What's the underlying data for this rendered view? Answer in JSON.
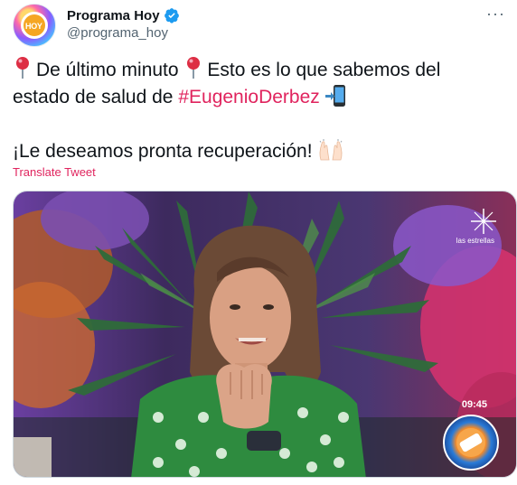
{
  "tweet": {
    "author": {
      "display_name": "Programa Hoy",
      "handle": "@programa_hoy",
      "verified": true,
      "avatar_icon": "programa-hoy-logo-icon",
      "avatar_text": "HOY"
    },
    "menu_icon": "more-options-icon",
    "text": {
      "line1_a": "De último minuto",
      "line1_b": "Esto es lo que sabemos del",
      "line2_a": "estado de salud de",
      "hashtag": "#EugenioDerbez",
      "line3": "¡Le deseamos pronta recuperación!",
      "emoji_icons": [
        "round-pushpin-icon",
        "round-pushpin-icon",
        "mobile-phone-arrow-icon",
        "raising-hands-icon"
      ]
    },
    "translate_label": "Translate Tweet",
    "colors": {
      "hashtag": "#e0245e",
      "verified_badge": "#1d9bf0",
      "secondary_text": "#536471"
    },
    "media": {
      "type": "video-still",
      "broadcaster_label": "las estrellas",
      "timestamp": "09:45",
      "broadcaster_icon": "las-estrellas-star-icon",
      "show_badge_icon": "hoy-show-badge-icon"
    }
  }
}
